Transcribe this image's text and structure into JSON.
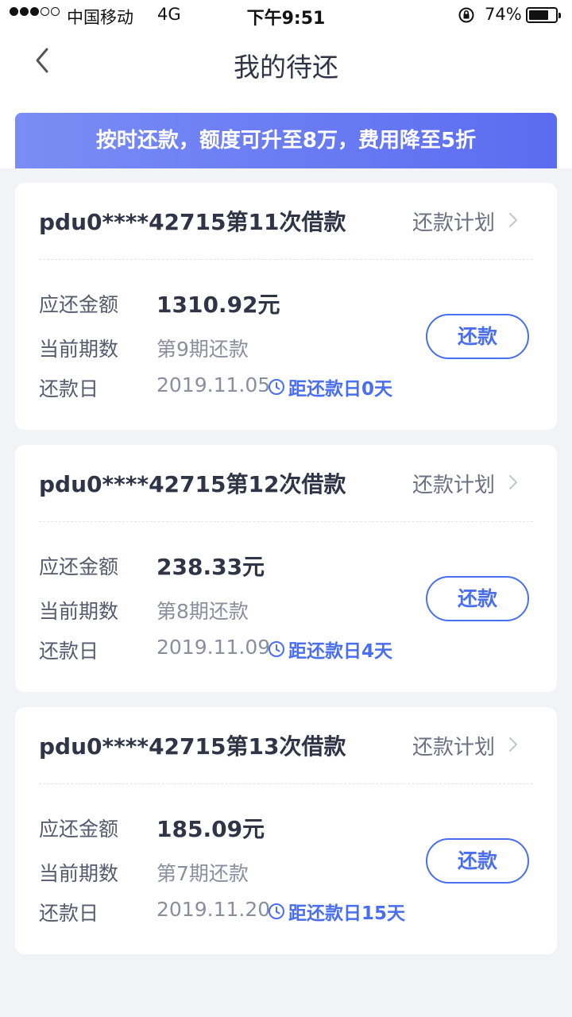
{
  "status_bar": {
    "carrier": "中国移动",
    "network": "4G",
    "time": "下午9:51",
    "battery": "74%",
    "battery_level": 0.74
  },
  "nav": {
    "title": "我的待还"
  },
  "banner": {
    "text": "按时还款，额度可升至8万，费用降至5折"
  },
  "labels": {
    "amount": "应还金额",
    "period": "当前期数",
    "due_date": "还款日",
    "plan_link": "还款计划",
    "pay_button": "还款"
  },
  "loans": [
    {
      "title": "pdu0****42715第11次借款",
      "amount": "1310.92元",
      "period": "第9期还款",
      "due_date": "2019.11.05",
      "countdown": "距还款日0天"
    },
    {
      "title": "pdu0****42715第12次借款",
      "amount": "238.33元",
      "period": "第8期还款",
      "due_date": "2019.11.09",
      "countdown": "距还款日4天"
    },
    {
      "title": "pdu0****42715第13次借款",
      "amount": "185.09元",
      "period": "第7期还款",
      "due_date": "2019.11.20",
      "countdown": "距还款日15天"
    }
  ],
  "colors": {
    "accent": "#4a6ef0",
    "banner_start": "#7a8df5",
    "banner_end": "#5b6cf0",
    "background": "#f2f3f7"
  },
  "icons": {
    "back": "chevron-left-icon",
    "plan_arrow": "chevron-right-icon",
    "countdown": "clock-icon",
    "rotation_lock": "rotation-lock-icon",
    "battery": "battery-icon"
  }
}
